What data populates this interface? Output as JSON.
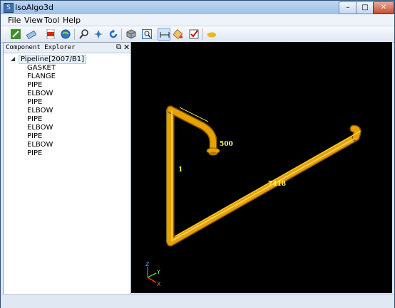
{
  "window": {
    "title": "IsoAlgo3d",
    "controls": {
      "minimize": "–",
      "maximize": "□",
      "close": "✕"
    }
  },
  "menu": [
    "File",
    "View",
    "Tool",
    "Help"
  ],
  "toolbar": [
    {
      "name": "pencil-icon"
    },
    {
      "name": "eraser-icon"
    },
    {
      "name": "pdf-icon"
    },
    {
      "name": "globe-icon"
    },
    {
      "name": "zoom-icon"
    },
    {
      "name": "fly-icon"
    },
    {
      "name": "rotate-icon"
    },
    {
      "name": "cube-view-icon"
    },
    {
      "name": "zoom-fit-icon"
    },
    {
      "name": "dimension-icon",
      "selected": true
    },
    {
      "name": "paint-icon"
    },
    {
      "name": "checklist-icon"
    },
    {
      "name": "bird-icon"
    }
  ],
  "component_explorer": {
    "title": "Component Explorer",
    "pin_icon": "⧉",
    "close_icon": "✕",
    "root": "Pipeline[2007/B1]",
    "children": [
      "GASKET",
      "FLANGE",
      "PIPE",
      "ELBOW",
      "PIPE",
      "ELBOW",
      "PIPE",
      "ELBOW",
      "PIPE",
      "ELBOW",
      "PIPE"
    ]
  },
  "viewport": {
    "dimensions": {
      "short_leg": "500",
      "long_run": "7418",
      "vertical": "1"
    },
    "axes": {
      "x": "X",
      "y": "Y",
      "z": "Z"
    },
    "colors": {
      "background": "#000000",
      "pipe": "#e8a200",
      "dimension": "#ffff66",
      "axis_x": "#ff3333",
      "axis_y": "#33dd33",
      "axis_z": "#3366ff"
    }
  }
}
